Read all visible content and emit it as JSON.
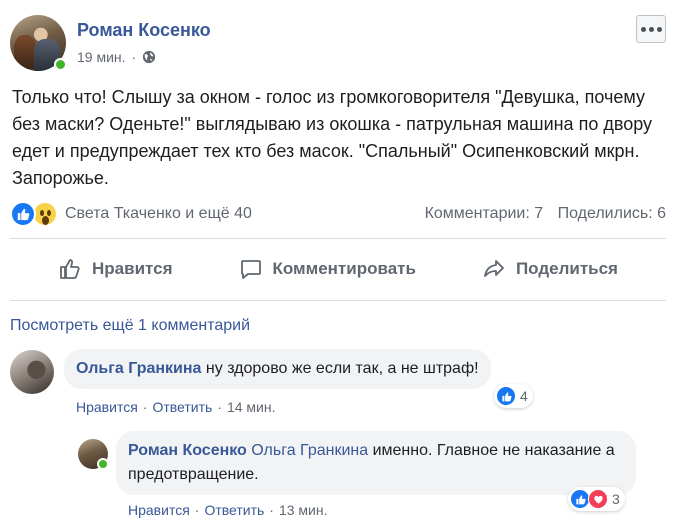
{
  "post": {
    "author": "Роман Косенко",
    "time": "19 мин.",
    "dot": "·",
    "text": "Только что! Слышу за окном - голос из громкоговорителя \"Девушка, почему без маски? Оденьте!\" выглядываю из окошка - патрульная машина по двору едет и предупреждает тех кто без масок. \"Спальный\" Осипенковский мкрн. Запорожье.",
    "reactors": "Света Ткаченко и ещё 40",
    "comments_count": "Комментарии: 7",
    "shares_count": "Поделились: 6"
  },
  "actions": {
    "like": "Нравится",
    "comment": "Комментировать",
    "share": "Поделиться"
  },
  "view_more": "Посмотреть ещё 1 комментарий",
  "comments": [
    {
      "author": "Ольга Гранкина",
      "text": "ну здорово же если так, а не штраф!",
      "like": "Нравится",
      "reply": "Ответить",
      "time": "14 мин.",
      "reactions_count": "4"
    },
    {
      "author": "Роман Косенко",
      "mention": "Ольга Гранкина",
      "text": "именно. Главное не наказание а предотвращение.",
      "like": "Нравится",
      "reply": "Ответить",
      "time": "13 мин.",
      "reactions_count": "3"
    }
  ],
  "colors": {
    "link": "#385898",
    "like_blue": "#1877f2",
    "love_red": "#f33e58",
    "wow_yellow": "#f7d146",
    "online_green": "#42b72a",
    "bubble_bg": "#f2f3f5"
  }
}
